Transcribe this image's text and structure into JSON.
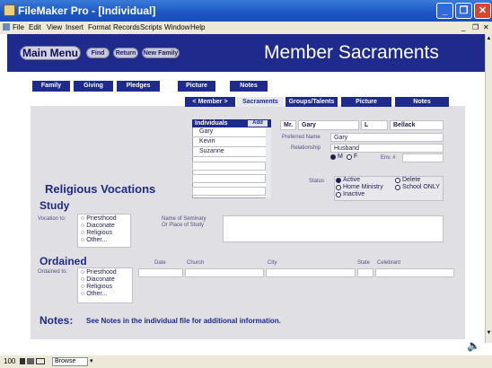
{
  "window": {
    "title": "FileMaker Pro - [Individual]"
  },
  "menu": [
    "File",
    "Edit",
    "View",
    "Insert",
    "Format",
    "Records",
    "Scripts",
    "Window",
    "Help"
  ],
  "header": {
    "main_menu": "Main Menu",
    "find": "Find",
    "return": "Return",
    "new_family": "New Family",
    "page_title": "Member Sacraments"
  },
  "tabs_top": [
    "Family",
    "Giving",
    "Pledges",
    "Picture",
    "Notes"
  ],
  "tabs_sub": [
    "< Member >",
    "Sacraments",
    "Groups/Talents",
    "Picture",
    "Notes"
  ],
  "individuals": {
    "header": "Individuals",
    "add": "Add",
    "names": [
      "Gary",
      "Kevin",
      "Suzanne"
    ]
  },
  "person": {
    "prefix": "Mr.",
    "first": "Gary",
    "middle": "L",
    "last": "Bellack",
    "preferred_label": "Preferred Name",
    "preferred": "Gary",
    "relationship_label": "Relationship",
    "relationship": "Husband",
    "gender_m": "M",
    "gender_f": "F",
    "env_label": "Env. #",
    "status_label": "Status",
    "status_options": [
      "Active",
      "Home Ministry",
      "Inactive",
      "Delete",
      "School ONLY"
    ]
  },
  "religious": {
    "title": "Religious Vocations",
    "study_title": "Study",
    "vocation_label": "Vocation to:",
    "vocation_options": [
      "Priesthood",
      "Diaconate",
      "Religious",
      "Other..."
    ],
    "seminary_label_1": "Name of Seminary",
    "seminary_label_2": "Or Place of Study",
    "ordained_title": "Ordained",
    "ordained_label": "Ordained to:",
    "ordained_options": [
      "Priesthood",
      "Diaconate",
      "Religious",
      "Other..."
    ],
    "cols": [
      "Date",
      "Church",
      "City",
      "State",
      "Celebrant"
    ]
  },
  "notes": {
    "title": "Notes:",
    "text": "See Notes in the individual file for additional information."
  },
  "statusbar": {
    "zoom": "100",
    "mode": "Browse"
  }
}
